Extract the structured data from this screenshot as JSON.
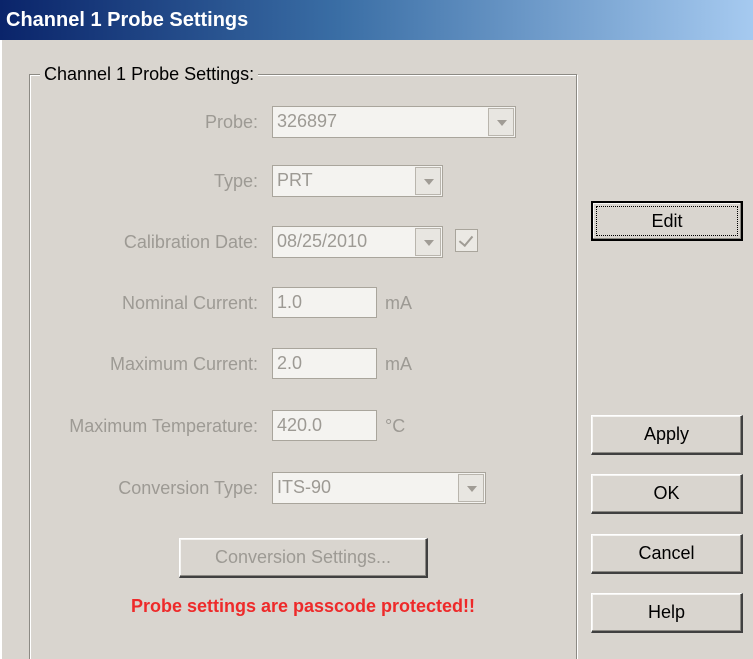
{
  "window": {
    "title": "Channel 1 Probe Settings"
  },
  "group": {
    "label": "Channel 1 Probe Settings:"
  },
  "fields": {
    "probe": {
      "label": "Probe:",
      "value": "326897"
    },
    "type": {
      "label": "Type:",
      "value": "PRT"
    },
    "calibration_date": {
      "label": "Calibration Date:",
      "value": "08/25/2010",
      "checked": true
    },
    "nominal_current": {
      "label": "Nominal Current:",
      "value": "1.0",
      "unit": "mA"
    },
    "maximum_current": {
      "label": "Maximum Current:",
      "value": "2.0",
      "unit": "mA"
    },
    "maximum_temperature": {
      "label": "Maximum Temperature:",
      "value": "420.0",
      "unit": "°C"
    },
    "conversion_type": {
      "label": "Conversion Type:",
      "value": "ITS-90"
    }
  },
  "buttons": {
    "conversion_settings": "Conversion Settings...",
    "edit": "Edit",
    "apply": "Apply",
    "ok": "OK",
    "cancel": "Cancel",
    "help": "Help"
  },
  "warning": "Probe settings are passcode protected!!",
  "colors": {
    "disabled_text": "#9d9a94",
    "warning": "#ee2a2a",
    "titlebar_start": "#0a246a",
    "titlebar_end": "#a6caf0"
  },
  "icons": [
    "chevron-down-icon",
    "checkmark-icon"
  ]
}
